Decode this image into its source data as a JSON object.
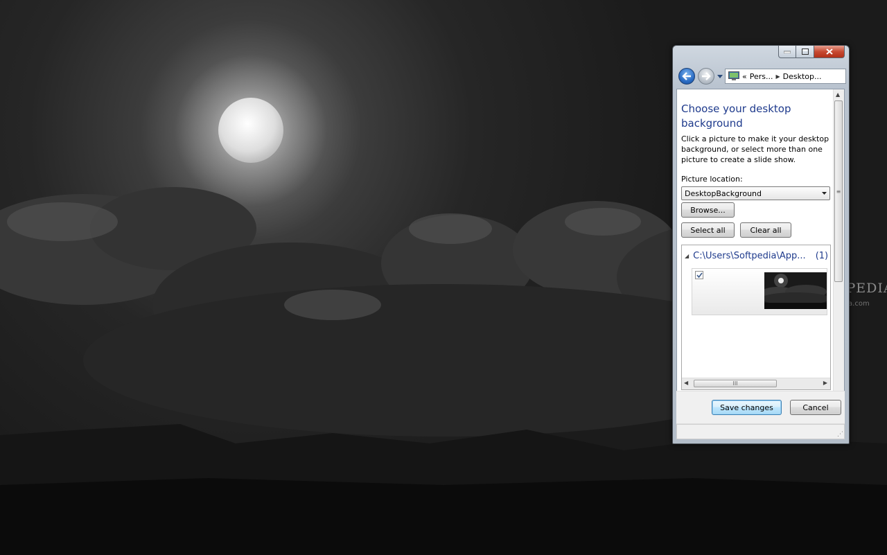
{
  "window": {
    "address": {
      "segments": [
        "«",
        "Pers...",
        "Desktop..."
      ]
    },
    "heading": "Choose your desktop background",
    "description": "Click a picture to make it your desktop background, or select more than one picture to create a slide show.",
    "picture_location_label": "Picture location:",
    "picture_location_value": "DesktopBackground",
    "browse_label": "Browse...",
    "select_all_label": "Select all",
    "clear_all_label": "Clear all",
    "group": {
      "path": "C:\\Users\\Softpedia\\App...",
      "count": "(1)"
    },
    "items": [
      {
        "checked": true
      }
    ],
    "save_label": "Save changes",
    "cancel_label": "Cancel",
    "hscroll_grip": "III",
    "vscroll_grip": "≡"
  },
  "watermark": {
    "text": "SOFTPEDIA™",
    "url": "www.softpedia.com"
  },
  "colors": {
    "heading": "#1e3a8c",
    "close_button": "#c74a32",
    "accent": "#3c7fb1"
  },
  "icons": [
    "minimize-icon",
    "maximize-icon",
    "close-icon",
    "back-arrow-icon",
    "forward-arrow-icon",
    "personalization-icon",
    "dropdown-arrow-icon",
    "collapse-triangle-icon",
    "checkmark-icon"
  ]
}
